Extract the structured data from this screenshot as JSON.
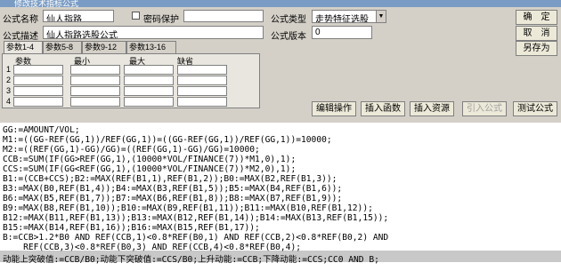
{
  "window": {
    "title": "修改技术指标公式"
  },
  "form": {
    "name_label": "公式名称",
    "name_value": "仙人指路",
    "password_label": "密码保护",
    "type_label": "公式类型",
    "type_value": "走势特征选股",
    "desc_label": "公式描述",
    "desc_value": "仙人指路选股公式",
    "version_label": "公式版本",
    "version_value": "0"
  },
  "buttons": {
    "ok": "确　定",
    "cancel": "取　消",
    "save_as": "另存为",
    "edit_ops": "编辑操作",
    "insert_func": "插入函数",
    "insert_resource": "插入资源",
    "import_formula": "引入公式",
    "test_formula": "测试公式"
  },
  "params": {
    "tabs": [
      "参数1-4",
      "参数5-8",
      "参数9-12",
      "参数13-16"
    ],
    "headers": [
      "参数",
      "最小",
      "最大",
      "缺省"
    ],
    "rows": [
      "1",
      "2",
      "3",
      "4"
    ]
  },
  "code_lines": [
    "GG:=AMOUNT/VOL;",
    "M1:=((GG-REF(GG,1))/REF(GG,1))=((GG-REF(GG,1))/REF(GG,1))=10000;",
    "M2:=((REF(GG,1)-GG)/GG)=((REF(GG,1)-GG)/GG)=10000;",
    "CCB:=SUM(IF(GG>REF(GG,1),(10000*VOL/FINANCE(7))*M1,0),1);",
    "CCS:=SUM(IF(GG<REF(GG,1),(10000*VOL/FINANCE(7))*M2,0),1);",
    "B1:=(CCB+CCS);B2:=MAX(REF(B1,1),REF(B1,2));B0:=MAX(B2,REF(B1,3));",
    "B3:=MAX(B0,REF(B1,4));B4:=MAX(B3,REF(B1,5));B5:=MAX(B4,REF(B1,6));",
    "B6:=MAX(B5,REF(B1,7));B7:=MAX(B6,REF(B1,8));B8:=MAX(B7,REF(B1,9));",
    "B9:=MAX(B8,REF(B1,10));B10:=MAX(B9,REF(B1,11));B11:=MAX(B10,REF(B1,12));",
    "B12:=MAX(B11,REF(B1,13));B13:=MAX(B12,REF(B1,14));B14:=MAX(B13,REF(B1,15));",
    "B15:=MAX(B14,REF(B1,16));B16:=MAX(B15,REF(B1,17));",
    "B:=CCB>1.2*B0 AND REF(CCB,1)<0.8*REF(B0,1) AND REF(CCB,2)<0.8*REF(B0,2) AND",
    "    REF(CCB,3)<0.8*REF(B0,3) AND REF(CCB,4)<0.8*REF(B0,4);",
    "动能上突破值:=CCB/B0;动能下突破值:=CCS/B0;上升动能:=CCB;下降动能:=CCS;CC0 AND B;"
  ]
}
